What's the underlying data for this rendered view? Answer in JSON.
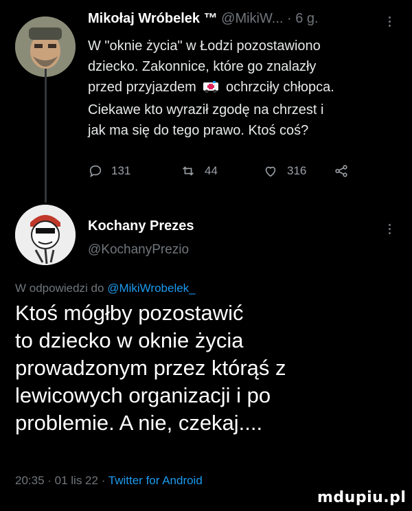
{
  "tweet1": {
    "author_name": "Mikołaj Wróbelek",
    "author_badge": "™",
    "handle": "@MikiW...",
    "time": "· 6 g.",
    "text_lines": [
      "W \"oknie życia\" w Łodzi pozostawiono",
      "dziecko. Zakonnice, które go znalazły",
      "przed przyjazdem",
      "ochrzciły chłopca.",
      "Ciekawe kto wyraził zgodę na chrzest i",
      "jak ma się do tego prawo. Ktoś coś?"
    ],
    "inline_emoji": "ambulance-icon",
    "replies": "131",
    "retweets": "44",
    "likes": "316"
  },
  "tweet2": {
    "author_name": "Kochany Prezes",
    "handle": "@KochanyPrezio",
    "reply_prefix": "W odpowiedzi do",
    "reply_to": "@MikiWrobelek_",
    "text_lines": [
      "Ktoś mógłby pozostawić",
      "to dziecko w oknie życia",
      "prowadzonym przez którąś z",
      "lewicowych organizacji i po",
      "problemie. A nie, czekaj...."
    ],
    "meta_time": "20:35 · 01 lis 22 ·",
    "meta_client": "Twitter for Android"
  },
  "watermark": "mdupiu.pl",
  "colors": {
    "background": "#000000",
    "text": "#e7e9ea",
    "muted": "#71767b",
    "accent": "#1d9bf0"
  }
}
